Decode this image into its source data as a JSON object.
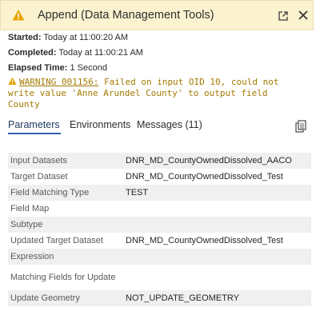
{
  "header": {
    "title": "Append (Data Management Tools)",
    "warning_color": "#e8a300"
  },
  "meta": {
    "started_label": "Started:",
    "started_value": "Today at 11:00:20 AM",
    "completed_label": "Completed:",
    "completed_value": "Today at 11:00:21 AM",
    "elapsed_label": "Elapsed Time:",
    "elapsed_value": "1 Second"
  },
  "warning": {
    "code": "WARNING 001156:",
    "message": "Failed on input OID 10, could not write value 'Anne Arundel County' to output field County"
  },
  "tabs": [
    {
      "label": "Parameters"
    },
    {
      "label": "Environments"
    },
    {
      "label": "Messages (11)"
    }
  ],
  "parameters": [
    {
      "name": "Input Datasets",
      "value": "DNR_MD_CountyOwnedDissolved_AACO"
    },
    {
      "name": "Target Dataset",
      "value": "DNR_MD_CountyOwnedDissolved_Test"
    },
    {
      "name": "Field Matching Type",
      "value": "TEST"
    },
    {
      "name": "Field Map",
      "value": ""
    },
    {
      "name": "Subtype",
      "value": ""
    },
    {
      "name": "Updated Target Dataset",
      "value": "DNR_MD_CountyOwnedDissolved_Test"
    },
    {
      "name": "Expression",
      "value": ""
    },
    {
      "name": "Matching Fields for Update",
      "value": ""
    },
    {
      "name": "Update Geometry",
      "value": "NOT_UPDATE_GEOMETRY"
    }
  ]
}
